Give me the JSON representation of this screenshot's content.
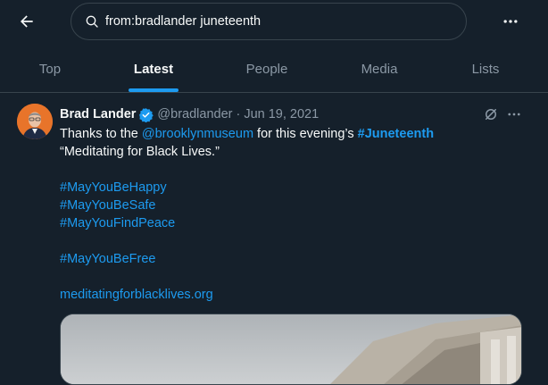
{
  "search": {
    "query": "from:bradlander juneteenth"
  },
  "tabs": [
    {
      "label": "Top",
      "active": false
    },
    {
      "label": "Latest",
      "active": true
    },
    {
      "label": "People",
      "active": false
    },
    {
      "label": "Media",
      "active": false
    },
    {
      "label": "Lists",
      "active": false
    }
  ],
  "tweet": {
    "author_name": "Brad Lander",
    "handle": "@bradlander",
    "separator": "·",
    "date": "Jun 19, 2021",
    "line1_prefix": "Thanks to the ",
    "mention": "@brooklynmuseum",
    "line1_middle": " for this evening’s ",
    "hashtag_juneteenth": "#Juneteenth",
    "line2": "“Meditating for Black Lives.”",
    "hashtags": [
      "#MayYouBeHappy",
      "#MayYouBeSafe",
      "#MayYouFindPeace"
    ],
    "hashtag_free": "#MayYouBeFree",
    "url": "meditatingforblacklives.org"
  },
  "colors": {
    "background": "#15202b",
    "accent": "#1d9bf0",
    "text_primary": "#f7f9f9",
    "text_secondary": "#8b98a5",
    "border": "#38444d",
    "avatar_bg": "#e8742a"
  },
  "icons": {
    "back": "arrow-left-icon",
    "search": "search-icon",
    "more": "more-horizontal-icon",
    "verified": "verified-badge-icon",
    "grok": "grok-icon"
  }
}
